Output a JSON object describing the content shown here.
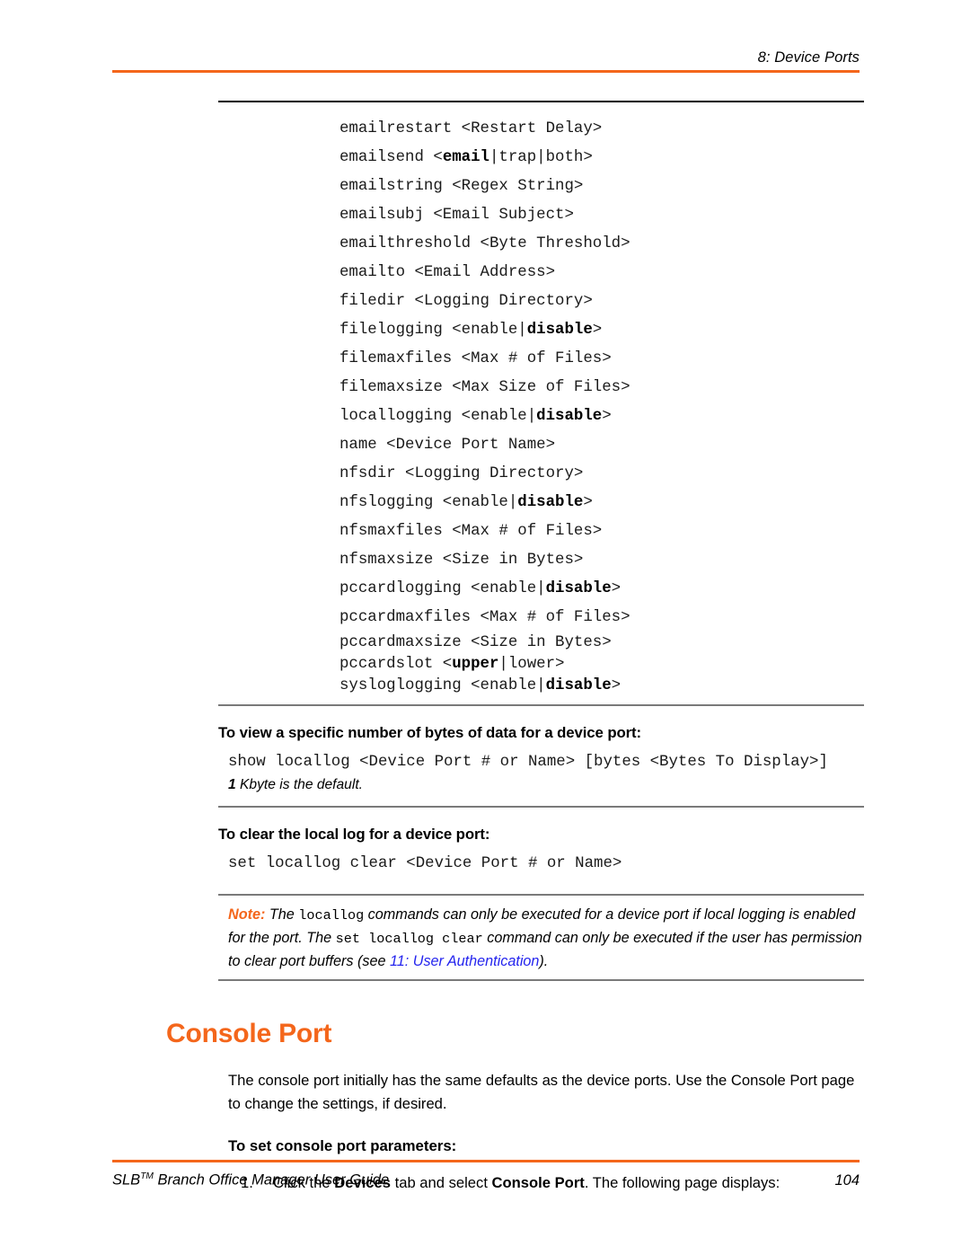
{
  "header": {
    "chapter_label": "8: Device Ports",
    "rule_color": "#F4661B"
  },
  "commands": [
    {
      "text": "emailrestart <Restart Delay>"
    },
    {
      "pre": "emailsend <",
      "bold": "email",
      "post": "|trap|both>"
    },
    {
      "text": "emailstring <Regex String>"
    },
    {
      "text": "emailsubj <Email Subject>"
    },
    {
      "text": "emailthreshold <Byte Threshold>"
    },
    {
      "text": "emailto <Email Address>"
    },
    {
      "text": "filedir <Logging Directory>"
    },
    {
      "pre": "filelogging <enable|",
      "bold": "disable",
      "post": ">"
    },
    {
      "text": "filemaxfiles <Max # of Files>"
    },
    {
      "text": "filemaxsize <Max Size of Files>"
    },
    {
      "pre": "locallogging <enable|",
      "bold": "disable",
      "post": ">"
    },
    {
      "text": "name <Device Port Name>"
    },
    {
      "text": "nfsdir <Logging Directory>"
    },
    {
      "pre": "nfslogging <enable|",
      "bold": "disable",
      "post": ">"
    },
    {
      "text": "nfsmaxfiles <Max # of Files>"
    },
    {
      "text": "nfsmaxsize <Size in Bytes>"
    },
    {
      "pre": "pccardlogging <enable|",
      "bold": "disable",
      "post": ">"
    },
    {
      "text": "pccardmaxfiles <Max # of Files>"
    },
    {
      "text": "pccardmaxsize <Size in Bytes>"
    },
    {
      "pre": "pccardslot <",
      "bold": "upper",
      "post": "|lower>"
    },
    {
      "pre": "sysloglogging <enable|",
      "bold": "disable",
      "post": ">"
    }
  ],
  "view_bytes_section": {
    "heading": "To view a specific number of bytes of data for a device port:",
    "command": "show locallog <Device Port # or Name> [bytes <Bytes To Display>]",
    "default_note_bold": "1",
    "default_note_rest": " Kbyte is the default."
  },
  "clear_log_section": {
    "heading": "To clear the local log for a device port:",
    "command": "set locallog clear <Device Port # or Name>"
  },
  "note_box": {
    "label": "Note:",
    "text_1": " The ",
    "mono_1": "locallog",
    "text_2": " commands can only be executed for a device port if local logging is enabled for the port. The ",
    "mono_2": "set locallog clear",
    "text_3": " command can only be executed if the user has permission to clear port buffers (see ",
    "link": "11: User Authentication",
    "text_4": ").",
    "label_color": "#F4661B",
    "link_color": "#2424EE"
  },
  "console_port_section": {
    "title": "Console Port",
    "title_color": "#F4661B",
    "paragraph": "The console port initially has the same defaults as the device ports. Use the Console Port page to change the settings, if desired.",
    "step_heading": "To set console port parameters:",
    "steps": [
      {
        "number": "1.",
        "pre": "Click the ",
        "bold_1": "Devices",
        "mid": " tab and select ",
        "bold_2": "Console Port",
        "post": ". The following page displays:"
      }
    ]
  },
  "footer": {
    "guide_name_pre": "SLB",
    "guide_name_tm": "TM",
    "guide_name_post": " Branch Office Manager User Guide",
    "page_number": "104",
    "rule_color": "#F4661B"
  }
}
